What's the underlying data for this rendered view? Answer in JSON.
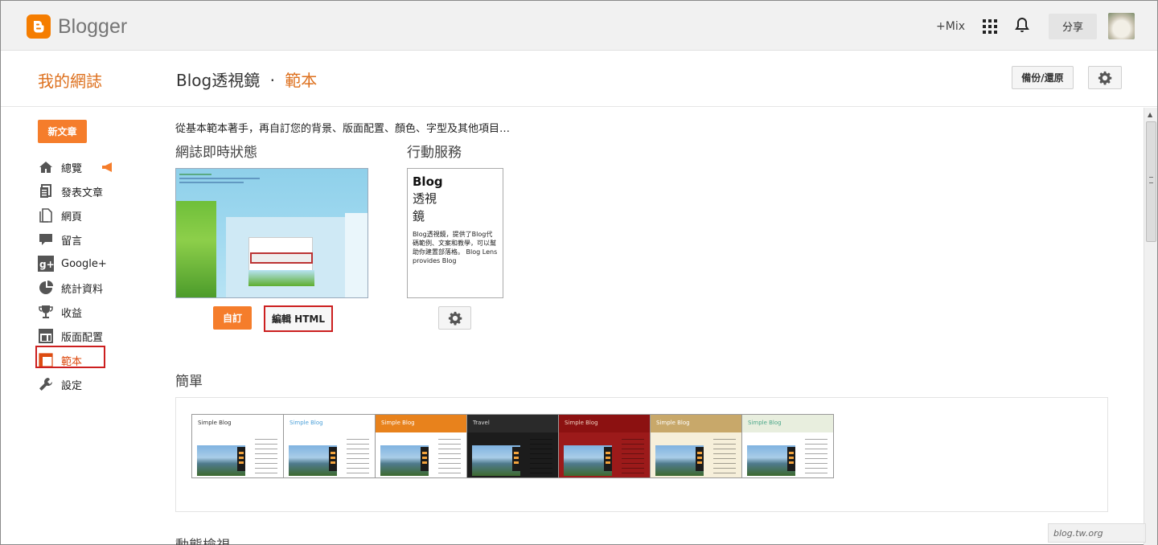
{
  "app": {
    "name": "Blogger",
    "brand_color": "#f57d00",
    "accent_color": "#dd6f1c"
  },
  "topbar": {
    "plus_mix": "+Mix",
    "share_label": "分享",
    "icons": [
      "apps-grid-icon",
      "notifications-bell-icon"
    ]
  },
  "header": {
    "my_blogs": "我的網誌",
    "blog_name": "Blog透視鏡",
    "separator": "·",
    "section": "範本",
    "backup_label": "備份/還原"
  },
  "sidebar": {
    "new_post": "新文章",
    "items": [
      {
        "label": "總覽",
        "icon": "home-icon"
      },
      {
        "label": "發表文章",
        "icon": "posts-icon"
      },
      {
        "label": "網頁",
        "icon": "pages-icon"
      },
      {
        "label": "留言",
        "icon": "comments-icon"
      },
      {
        "label": "Google+",
        "icon": "google-plus-icon"
      },
      {
        "label": "統計資料",
        "icon": "stats-pie-icon"
      },
      {
        "label": "收益",
        "icon": "earnings-trophy-icon"
      },
      {
        "label": "版面配置",
        "icon": "layout-icon"
      },
      {
        "label": "範本",
        "icon": "template-icon",
        "active": true
      },
      {
        "label": "設定",
        "icon": "wrench-icon"
      }
    ]
  },
  "main": {
    "intro": "從基本範本著手，再自訂您的背景、版面配置、顏色、字型及其他項目…",
    "live_heading": "網誌即時狀態",
    "mobile_heading": "行動服務",
    "customize_label": "自訂",
    "edit_html_label": "編輯 HTML",
    "mobile_preview": {
      "title": "Blog",
      "sub1": "透視",
      "sub2": "鏡",
      "desc": "Blog透視鏡，提供了Blog代碼範例、文案和教學，可以幫助你建置部落格。 Blog Lens provides Blog"
    },
    "simple_heading": "簡單",
    "themes": [
      {
        "title": "Simple Blog",
        "header_bg": "#ffffff",
        "title_color": "#333333",
        "body_bg": "#ffffff"
      },
      {
        "title": "Simple Blog",
        "header_bg": "#ffffff",
        "title_color": "#4a9fd8",
        "body_bg": "#ffffff"
      },
      {
        "title": "Simple Blog",
        "header_bg": "#e8821c",
        "title_color": "#ffffff",
        "body_bg": "#ffffff"
      },
      {
        "title": "Travel",
        "header_bg": "#2a2a2a",
        "title_color": "#dddddd",
        "body_bg": "#1c1c1c"
      },
      {
        "title": "Simple Blog",
        "header_bg": "#8c1111",
        "title_color": "#f0d0c0",
        "body_bg": "#9c1a1a"
      },
      {
        "title": "Simple Blog",
        "header_bg": "#c8a86a",
        "title_color": "#ffffff",
        "body_bg": "#f6efda"
      },
      {
        "title": "Simple Blog",
        "header_bg": "#e8eede",
        "title_color": "#4ba78a",
        "body_bg": "#ffffff"
      }
    ],
    "dynamic_heading": "動態檢視"
  },
  "watermark": "blog.tw.org"
}
